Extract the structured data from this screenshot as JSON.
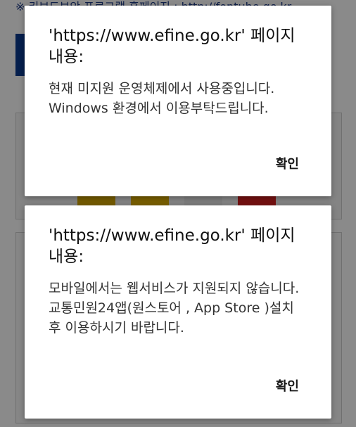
{
  "background_page": {
    "top_link_text": "※ 키보드보안 프로그램 홈페이지 : http://fontube.go.kr"
  },
  "dialogs": [
    {
      "title": "'https://www.efine.go.kr' 페이지 내용:",
      "message": " 현재 미지원 운영체제에서 사용중입니다. Windows 환경에서 이용부탁드립니다.",
      "ok_label": "확인"
    },
    {
      "title": "'https://www.efine.go.kr' 페이지 내용:",
      "message": "모바일에서는 웹서비스가 지원되지 않습니다.\n교통민원24앱(원스토어 , App Store )설치 후 이용하시기 바랍니다.",
      "ok_label": "확인"
    }
  ],
  "colors": {
    "scrim": "#000000",
    "dialog_bg": "#ffffff",
    "page_link": "#1f3c88",
    "page_brand_bar": "#0a3a8f"
  }
}
